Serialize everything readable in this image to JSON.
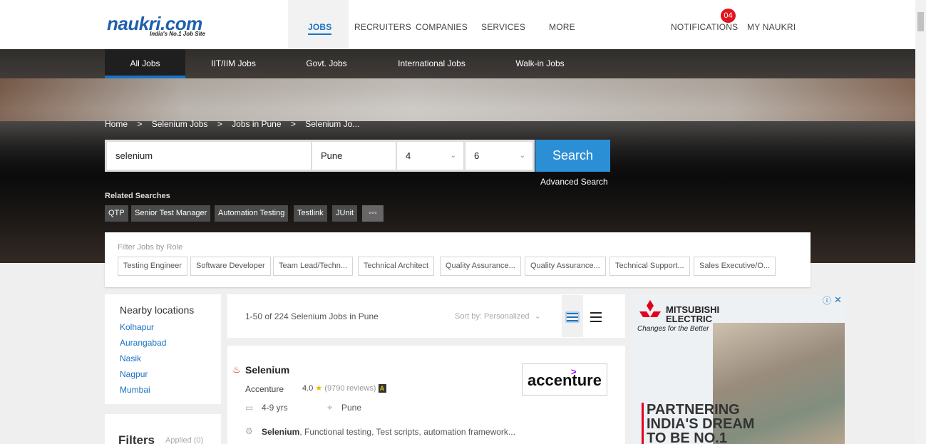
{
  "header": {
    "logo_text": "naukri.com",
    "logo_tagline": "India's No.1 Job Site",
    "nav": [
      "JOBS",
      "RECRUITERS",
      "COMPANIES",
      "SERVICES",
      "MORE"
    ],
    "notifications_label": "NOTIFICATIONS",
    "notifications_count": "04",
    "my_naukri": "MY NAUKRI"
  },
  "subnav": [
    "All Jobs",
    "IIT/IIM Jobs",
    "Govt. Jobs",
    "International Jobs",
    "Walk-in Jobs"
  ],
  "breadcrumb": [
    "Home",
    ">",
    "Selenium Jobs",
    ">",
    "Jobs in Pune",
    ">",
    "Selenium Jo..."
  ],
  "search": {
    "keyword": "selenium",
    "location": "Pune",
    "exp_min": "4",
    "exp_max": "6",
    "button": "Search",
    "advanced": "Advanced Search"
  },
  "related": {
    "label": "Related Searches",
    "chips": [
      "QTP",
      "Senior Test Manager",
      "Automation Testing",
      "Testlink",
      "JUnit",
      "◦◦◦"
    ]
  },
  "roles": {
    "label": "Filter Jobs by Role",
    "chips": [
      "Testing Engineer",
      "Software Developer",
      "Team Lead/Techn...",
      "Technical Architect",
      "Quality Assurance...",
      "Quality Assurance...",
      "Technical Support...",
      "Sales Executive/O..."
    ]
  },
  "nearby": {
    "title": "Nearby locations",
    "items": [
      "Kolhapur",
      "Aurangabad",
      "Nasik",
      "Nagpur",
      "Mumbai"
    ]
  },
  "filters": {
    "title": "Filters",
    "applied": "Applied (0)"
  },
  "results": {
    "count": "1-50 of 224 Selenium Jobs in Pune",
    "sort": "Sort by: Personalized"
  },
  "job": {
    "title": "Selenium",
    "company": "Accenture",
    "rating": "4.0",
    "reviews": "(9790 reviews)",
    "badge": "A",
    "experience": "4-9 yrs",
    "location": "Pune",
    "skills_bold": "Selenium",
    "skills_rest": ", Functional testing, Test scripts, automation framework...",
    "logo_text": "accenture"
  },
  "ad": {
    "brand_line1": "MITSUBISHI",
    "brand_line2": "ELECTRIC",
    "tagline": "Changes for the Better",
    "headline_line1": "PARTNERING",
    "headline_line2": "INDIA'S DREAM",
    "headline_line3": "TO BE NO.1"
  },
  "colors": {
    "accent": "#1a72c4",
    "search_button": "#2b8fd6",
    "badge": "#e0161f"
  }
}
